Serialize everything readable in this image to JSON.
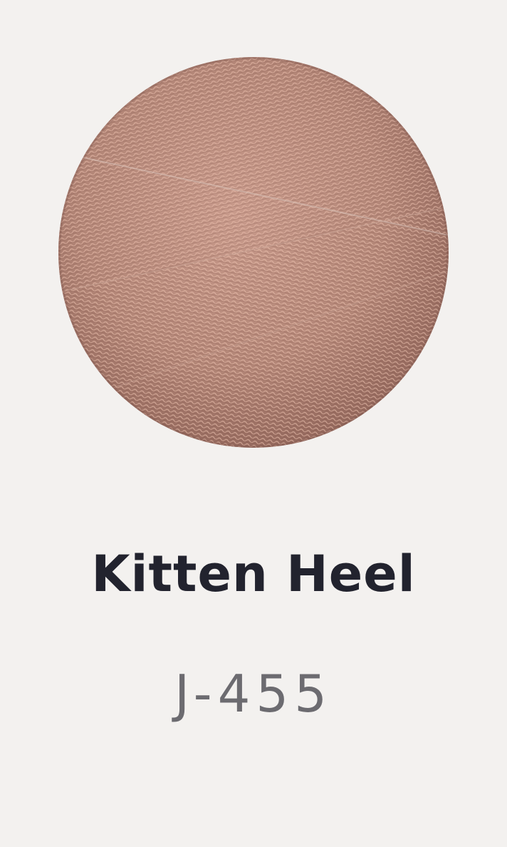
{
  "swatch": {
    "icon": "thread-spool-texture-icon",
    "base_color": "#b88a7c",
    "highlight_color": "#e3b7a7",
    "shadow_color": "#8e6358"
  },
  "product": {
    "name": "Kitten Heel",
    "code": "J-455"
  }
}
